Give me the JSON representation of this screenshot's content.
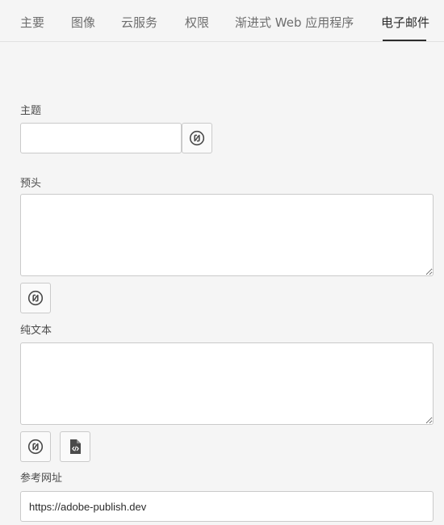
{
  "tabs": [
    {
      "label": "主要",
      "active": false
    },
    {
      "label": "图像",
      "active": false
    },
    {
      "label": "云服务",
      "active": false
    },
    {
      "label": "权限",
      "active": false
    },
    {
      "label": "渐进式 Web 应用程序",
      "active": false
    },
    {
      "label": "电子邮件",
      "active": true
    }
  ],
  "fields": {
    "subject": {
      "label": "主题",
      "value": ""
    },
    "preheader": {
      "label": "预头",
      "value": ""
    },
    "plaintext": {
      "label": "纯文本",
      "value": ""
    },
    "reference_url": {
      "label": "参考网址",
      "value": "https://adobe-publish.dev"
    }
  },
  "icons": {
    "personalization": "personalization-link-icon",
    "code": "code-file-icon"
  },
  "colors": {
    "background": "#f5f5f5",
    "active_tab": "#2c2c2c",
    "inactive_tab": "#6e6e6e",
    "border": "#cacaca"
  }
}
